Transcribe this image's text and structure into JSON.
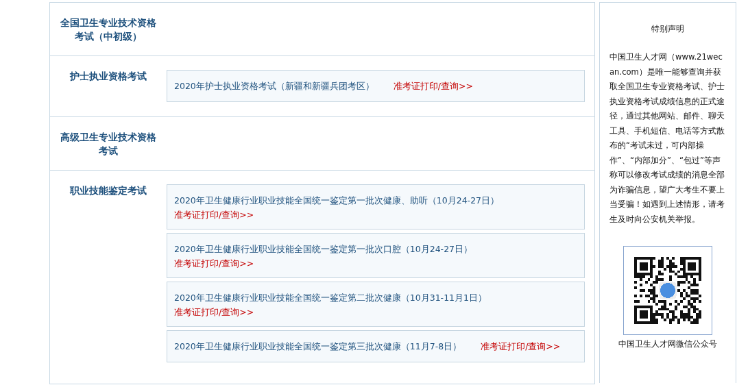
{
  "sections": [
    {
      "title": "全国卫生专业技术资格考试（中初级）"
    },
    {
      "title": "护士执业资格考试",
      "entries": [
        {
          "kind": "inline",
          "text": "2020年护士执业资格考试（新疆和新疆兵团考区）",
          "link": "准考证打印/查询>>"
        }
      ]
    },
    {
      "title": "高级卫生专业技术资格考试"
    },
    {
      "title": "职业技能鉴定考试",
      "entries": [
        {
          "kind": "stacked",
          "text": "2020年卫生健康行业职业技能全国统一鉴定第一批次健康、助听（10月24-27日）",
          "link": "准考证打印/查询>>"
        },
        {
          "kind": "stacked",
          "text": "2020年卫生健康行业职业技能全国统一鉴定第一批次口腔（10月24-27日）",
          "link": "准考证打印/查询>>"
        },
        {
          "kind": "stacked",
          "text": "2020年卫生健康行业职业技能全国统一鉴定第二批次健康（10月31-11月1日）",
          "link": "准考证打印/查询>>"
        },
        {
          "kind": "inline",
          "text": "2020年卫生健康行业职业技能全国统一鉴定第三批次健康（11月7-8日）",
          "link": "准考证打印/查询>>"
        }
      ]
    }
  ],
  "sidebar": {
    "title": "特别声明",
    "notice": "中国卫生人才网（www.21wecan.com）是唯一能够查询并获取全国卫生专业资格考试、护士执业资格考试成绩信息的正式途径，通过其他网站、邮件、聊天工具、手机短信、电话等方式散布的“考试未过，可内部操作”、“内部加分”、“包过”等声称可以修改考试成绩的消息全部为诈骗信息，望广大考生不要上当受骗！如遇到上述情形，请考生及时向公安机关举报。",
    "qr_caption": "中国卫生人才网微信公众号"
  }
}
